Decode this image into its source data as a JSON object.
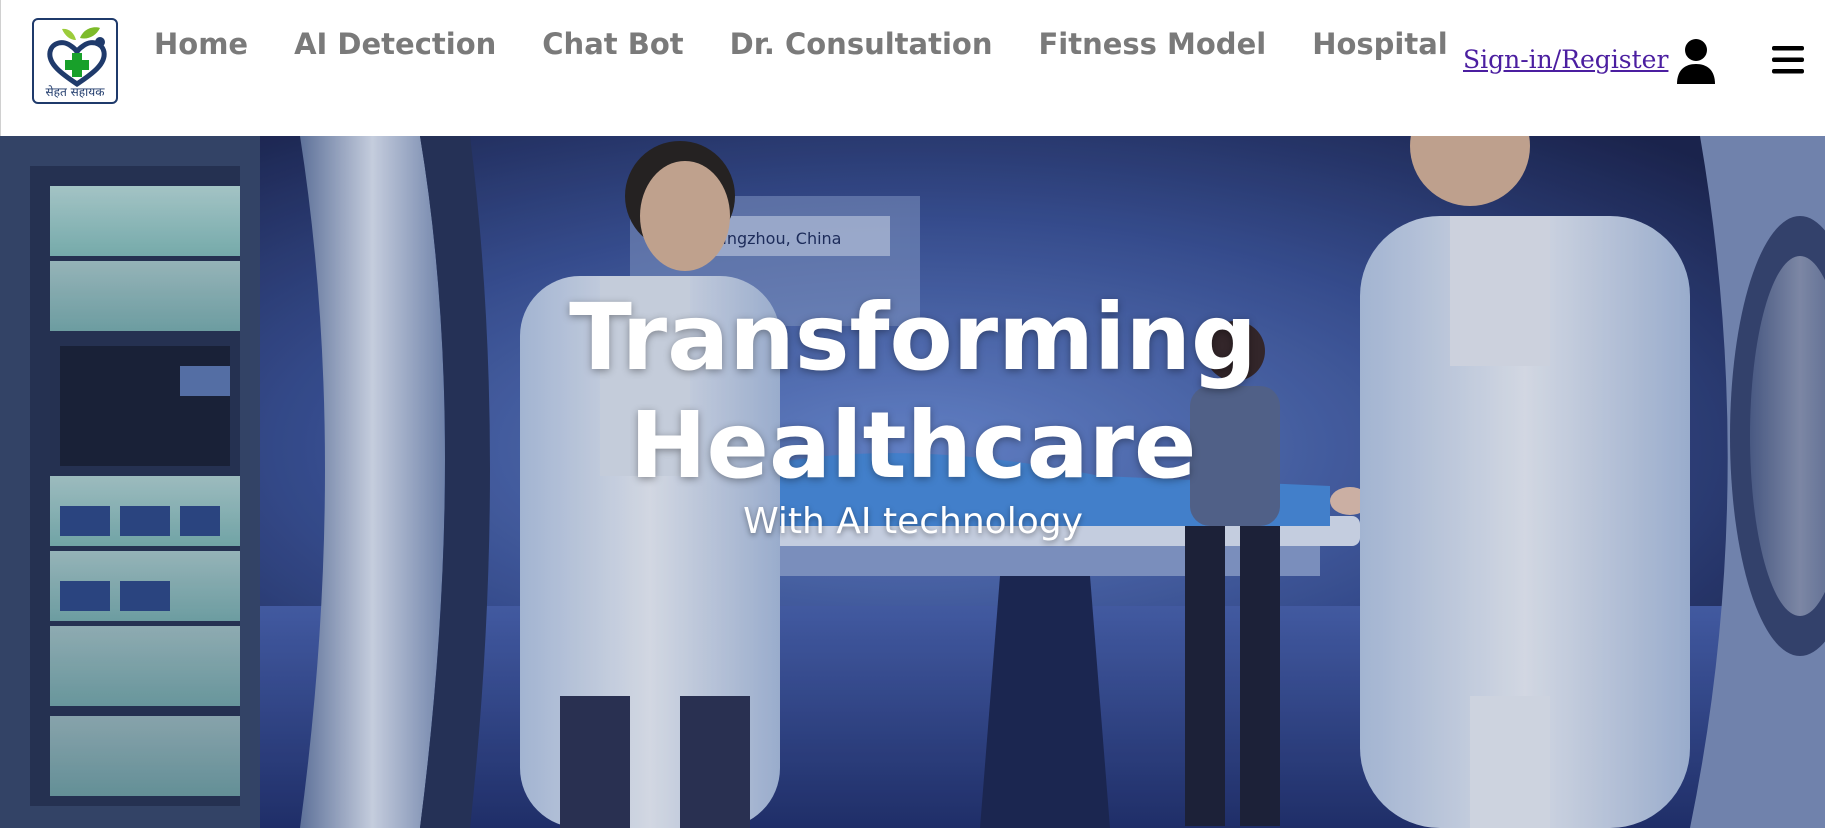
{
  "brand": {
    "logo_caption": "सेहत सहायक"
  },
  "nav": {
    "items": [
      {
        "label": "Home"
      },
      {
        "label": "AI Detection"
      },
      {
        "label": "Chat Bot"
      },
      {
        "label": "Dr. Consultation"
      },
      {
        "label": "Fitness Model"
      },
      {
        "label": "Hospital"
      }
    ],
    "signin_label": "Sign-in/Register",
    "user_icon": "user-icon",
    "menu_icon": "hamburger-menu-icon"
  },
  "hero": {
    "title_line1": "Transforming",
    "title_line2": "Healthcare",
    "subtitle": "With AI technology",
    "background_image": "doctors-with-mri-scanner-and-patient",
    "overlay_screen_text": "Hangzhou, China"
  },
  "colors": {
    "nav_text": "#7a7a7a",
    "signin_link": "#4b1ea0",
    "logo_border": "#1f3a6b",
    "hero_text": "#ffffff",
    "logo_green": "#18a02a"
  }
}
